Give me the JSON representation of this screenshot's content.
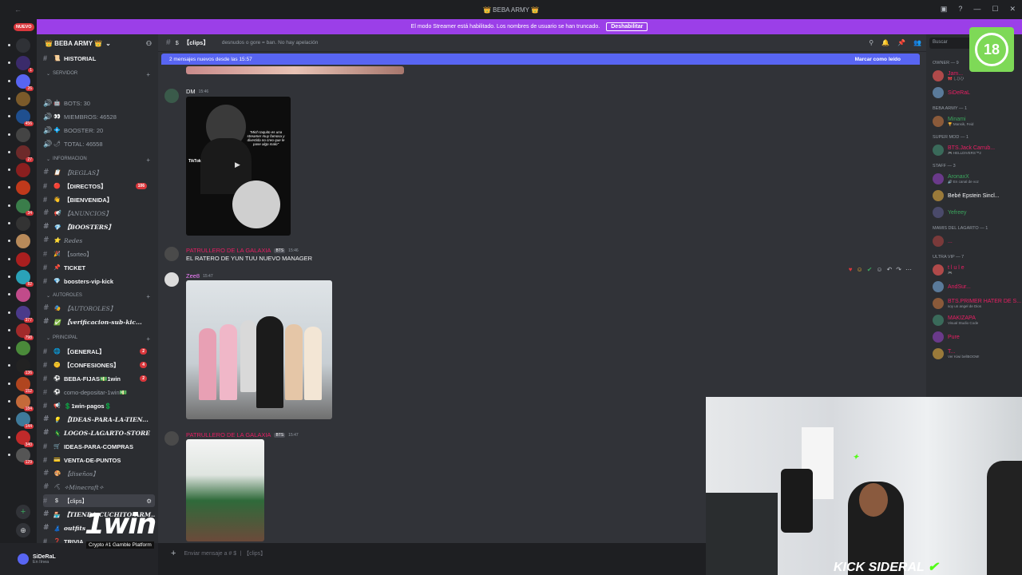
{
  "window": {
    "title": "👑 BEBA ARMY 👑",
    "back": "←",
    "controls": [
      "▣",
      "?",
      "—",
      "☐",
      "✕"
    ]
  },
  "banner": {
    "text": "El modo Streamer está habilitado. Los nombres de usuario se han truncado.",
    "button": "Deshabilitar",
    "color": "#9b3fe8"
  },
  "nuevo_label": "NUEVO",
  "server": {
    "name": "👑 BEBA ARMY 👑",
    "chevron": "⌄"
  },
  "servers": [
    {
      "color": "#2f3136",
      "badge": ""
    },
    {
      "color": "#3b2b6b",
      "badge": "1"
    },
    {
      "color": "#5865f2",
      "badge": "26"
    },
    {
      "color": "#7b5a2a",
      "badge": ""
    },
    {
      "color": "#1f4f8f",
      "badge": "456"
    },
    {
      "color": "#444",
      "badge": ""
    },
    {
      "color": "#6d2a2a",
      "badge": "27"
    },
    {
      "color": "#8a1f1f",
      "badge": ""
    },
    {
      "color": "#c0391b",
      "badge": ""
    },
    {
      "color": "#3a7d4a",
      "badge": "34"
    },
    {
      "color": "#333",
      "badge": ""
    },
    {
      "color": "#b88a5a",
      "badge": ""
    },
    {
      "color": "#aa1f1f",
      "badge": ""
    },
    {
      "color": "#2aa2b8",
      "badge": "82"
    },
    {
      "color": "#c14b8a",
      "badge": ""
    },
    {
      "color": "#4b3a8a",
      "badge": "377"
    },
    {
      "color": "#a12a2a",
      "badge": "798"
    },
    {
      "color": "#4a8a3a",
      "badge": ""
    },
    {
      "color": "#222",
      "badge": "136"
    },
    {
      "color": "#b0451f",
      "badge": "152"
    },
    {
      "color": "#c46a3a",
      "badge": "184"
    },
    {
      "color": "#3f7a9a",
      "badge": "144"
    },
    {
      "color": "#c02a2a",
      "badge": "340"
    },
    {
      "color": "#555",
      "badge": "129"
    }
  ],
  "categories": {
    "servidor": "SERVIDOR",
    "informacion": "INFORMACION",
    "autoroles": "AUTOROLES",
    "principal": "PRINCIPAL"
  },
  "channels": [
    {
      "label": "HISTORIAL",
      "icon": "📜",
      "kind": "text"
    },
    {
      "label": "BOTS: 30",
      "icon": "🤖",
      "kind": "voice"
    },
    {
      "label": "MIEMBROS: 46528",
      "icon": "👀",
      "kind": "voice"
    },
    {
      "label": "BOOSTER: 20",
      "icon": "💠",
      "kind": "voice"
    },
    {
      "label": "TOTAL: 46558",
      "icon": "🌶",
      "kind": "voice"
    },
    {
      "label": "【REGLAS】",
      "icon": "📋",
      "kind": "text"
    },
    {
      "label": "【DIRECTOS】",
      "icon": "🔴",
      "kind": "text",
      "count": "106"
    },
    {
      "label": "【BIENVENIDA】",
      "icon": "👋",
      "kind": "text"
    },
    {
      "label": "【ANUNCIOS】",
      "icon": "📢",
      "kind": "text"
    },
    {
      "label": "【BOOSTERS】",
      "icon": "💎",
      "kind": "text"
    },
    {
      "label": "Redes",
      "icon": "⭐",
      "kind": "text"
    },
    {
      "label": "【sorteo】",
      "icon": "🎉",
      "kind": "text"
    },
    {
      "label": "TICKET",
      "icon": "📌",
      "kind": "text"
    },
    {
      "label": "boosters-vip-kick",
      "icon": "💎",
      "kind": "text"
    },
    {
      "label": "【AUTOROLES】",
      "icon": "🎭",
      "kind": "text"
    },
    {
      "label": "【verificacion-sub-kic...",
      "icon": "✅",
      "kind": "text"
    },
    {
      "label": "【GENERAL】",
      "icon": "🌐",
      "kind": "text",
      "count": "2"
    },
    {
      "label": "【CONFESIONES】",
      "icon": "🤫",
      "kind": "text",
      "count": "4"
    },
    {
      "label": "BEBA-FIJAS💵1win",
      "icon": "⚽",
      "kind": "text",
      "count": "2"
    },
    {
      "label": "como-depositar-1win💵",
      "icon": "⚽",
      "kind": "text"
    },
    {
      "label": "💲1win-pagos💲",
      "icon": "📢",
      "kind": "text"
    },
    {
      "label": "【IDEAS-PARA-LA-TIEN...",
      "icon": "💡",
      "kind": "text"
    },
    {
      "label": "LOGOS-LAGARTO-STORE",
      "icon": "🦎",
      "kind": "text"
    },
    {
      "label": "IDEAS-PARA-COMPRAS",
      "icon": "🛒",
      "kind": "text"
    },
    {
      "label": "VENTA-DE-PUNTOS",
      "icon": "💳",
      "kind": "text"
    },
    {
      "label": "【diseños】",
      "icon": "🎨",
      "kind": "text"
    },
    {
      "label": "✧Minecraft✧",
      "icon": "⛏",
      "kind": "text"
    },
    {
      "label": "【clips】",
      "icon": "$",
      "kind": "text"
    },
    {
      "label": "【TIENDA-CUCHITO-ARM...",
      "icon": "🏪",
      "kind": "text"
    },
    {
      "label": "outfits",
      "icon": "👗",
      "kind": "text"
    },
    {
      "label": "TRIVIA",
      "icon": "❓",
      "kind": "text"
    },
    {
      "label": "【VOCES...",
      "icon": "🔊",
      "kind": "text"
    }
  ],
  "user": {
    "name": "SiDeRaL",
    "status": "En línea"
  },
  "promo": {
    "logo": "1win",
    "tagline": "Crypto #1 Gamble Platform"
  },
  "chat": {
    "channel_name": "【clips】",
    "channel_prefix": "$",
    "topic": "desnudos o gore = ban. No hay apelación",
    "new_messages": "2 mensajes nuevos desde las 15:57",
    "mark_read": "Marcar como leído",
    "composer_placeholder": "Enviar mensaje a # $ 丨【clips】",
    "messages": [
      {
        "author": "DM",
        "color": "#f2f3f5",
        "time": "15:46",
        "text": ""
      },
      {
        "author": "PATRULLERO DE LA GALAXIA",
        "color": "#e91e63",
        "tag": "BTS",
        "time": "15:46",
        "text": "EL RATERO DE YUN TUU NUEVO MANAGER"
      },
      {
        "author": "Zee8",
        "color": "#f47fff",
        "time": "15:47",
        "text": ""
      },
      {
        "author": "PATRULLERO DE LA GALAXIA",
        "color": "#e91e63",
        "tag": "BTS",
        "time": "15:47",
        "text": ""
      }
    ],
    "tiktok_caption": "\"Mich taquito es una streamer muy famosa y divertida no creo que le pase algo malo\"",
    "tiktok_label": "TikTok"
  },
  "members": {
    "search_placeholder": "Buscar",
    "groups": [
      {
        "title": "OWNER — 9",
        "members": [
          {
            "name": "Jam...",
            "color": "#e91e63",
            "sub": "🎀 しひひ"
          },
          {
            "name": "SiDeRaL",
            "color": "#e91e63",
            "sub": ""
          }
        ]
      },
      {
        "title": "BEBA ARMY — 1",
        "members": [
          {
            "name": "Minami",
            "color": "#3ba55d",
            "sub": "🏆 Mansik, Feid"
          }
        ]
      },
      {
        "title": "SUPER MOD — 1",
        "members": [
          {
            "name": "BTS.Jack Carrub...",
            "color": "#e91e63",
            "sub": "🎮 HELLDIVERS™2"
          }
        ]
      },
      {
        "title": "STAFF — 3",
        "members": [
          {
            "name": "AronaxX",
            "color": "#3ba55d",
            "sub": "🔊 En canal de voz"
          },
          {
            "name": "Bebé Epstein Sincl...",
            "color": "#f2f3f5",
            "sub": ""
          },
          {
            "name": "Yefreey",
            "color": "#3ba55d",
            "sub": ""
          }
        ]
      },
      {
        "title": "Mamis Del Lagarto — 1",
        "members": [
          {
            "name": "...",
            "color": "#e91e63",
            "sub": ""
          }
        ]
      },
      {
        "title": "ULTRA VIP — 7",
        "members": [
          {
            "name": "t l u l e",
            "color": "#e91e63",
            "sub": "🎮"
          },
          {
            "name": "AndSur...",
            "color": "#e91e63",
            "sub": ""
          },
          {
            "name": "BTS.PRIMER HATER DE S...",
            "color": "#e91e63",
            "sub": "soy un angel de Dios"
          },
          {
            "name": "MAKIZAPA",
            "color": "#e91e63",
            "sub": "Visual Studio Code"
          },
          {
            "name": "Pure",
            "color": "#e91e63",
            "sub": ""
          },
          {
            "name": "T...",
            "color": "#e91e63",
            "sub": "Ver Kiwi bellBOOM!"
          }
        ]
      }
    ]
  },
  "rating_badge": "18",
  "watermark": {
    "brand": "KICK",
    "streamer": "SIDERAL",
    "check": "✔"
  },
  "colors": {
    "accent": "#5865f2",
    "kick_green": "#53fc18"
  }
}
